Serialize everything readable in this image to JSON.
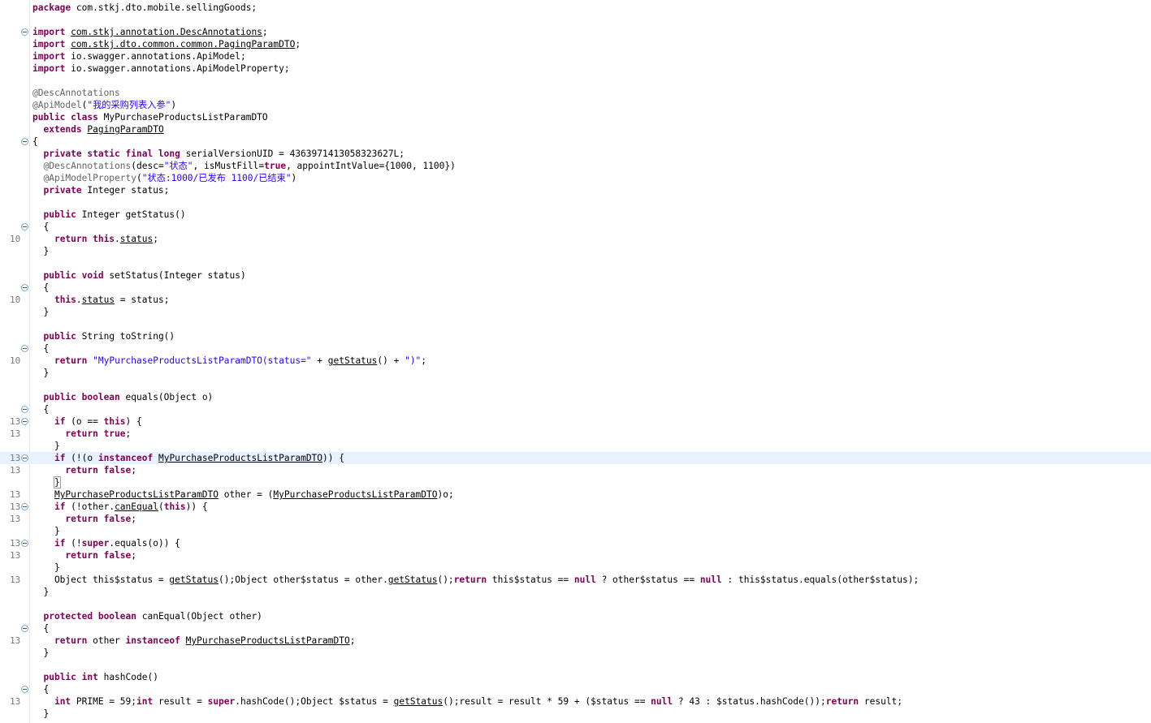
{
  "lines": [
    {
      "ln": "",
      "fold": false,
      "tokens": [
        {
          "t": "package",
          "c": "kw"
        },
        {
          "t": " com.stkj.dto.mobile.sellingGoods;"
        }
      ]
    },
    {
      "ln": "",
      "fold": false,
      "tokens": []
    },
    {
      "ln": "",
      "fold": true,
      "tokens": [
        {
          "t": "import",
          "c": "kw"
        },
        {
          "t": " "
        },
        {
          "t": "com.stkj.annotation.DescAnnotations",
          "c": "u"
        },
        {
          "t": ";"
        }
      ]
    },
    {
      "ln": "",
      "fold": false,
      "tokens": [
        {
          "t": "import",
          "c": "kw"
        },
        {
          "t": " "
        },
        {
          "t": "com.stkj.dto.common.common.PagingParamDTO",
          "c": "u"
        },
        {
          "t": ";"
        }
      ]
    },
    {
      "ln": "",
      "fold": false,
      "tokens": [
        {
          "t": "import",
          "c": "kw"
        },
        {
          "t": " io.swagger.annotations.ApiModel;"
        }
      ]
    },
    {
      "ln": "",
      "fold": false,
      "tokens": [
        {
          "t": "import",
          "c": "kw"
        },
        {
          "t": " io.swagger.annotations.ApiModelProperty;"
        }
      ]
    },
    {
      "ln": "",
      "fold": false,
      "tokens": []
    },
    {
      "ln": "",
      "fold": false,
      "tokens": [
        {
          "t": "@DescAnnotations",
          "c": "ann"
        }
      ]
    },
    {
      "ln": "",
      "fold": false,
      "tokens": [
        {
          "t": "@ApiModel",
          "c": "ann"
        },
        {
          "t": "("
        },
        {
          "t": "\"我的采购列表入参\"",
          "c": "str"
        },
        {
          "t": ")"
        }
      ]
    },
    {
      "ln": "",
      "fold": false,
      "tokens": [
        {
          "t": "public",
          "c": "kw"
        },
        {
          "t": " "
        },
        {
          "t": "class",
          "c": "kw"
        },
        {
          "t": " MyPurchaseProductsListParamDTO"
        }
      ]
    },
    {
      "ln": "",
      "fold": false,
      "tokens": [
        {
          "t": "  "
        },
        {
          "t": "extends",
          "c": "kw"
        },
        {
          "t": " "
        },
        {
          "t": "PagingParamDTO",
          "c": "u"
        }
      ]
    },
    {
      "ln": "",
      "fold": true,
      "tokens": [
        {
          "t": "{"
        }
      ]
    },
    {
      "ln": "",
      "fold": false,
      "tokens": [
        {
          "t": "  "
        },
        {
          "t": "private static final long",
          "c": "kw"
        },
        {
          "t": " serialVersionUID = 4363971413058323627L;"
        }
      ]
    },
    {
      "ln": "",
      "fold": false,
      "tokens": [
        {
          "t": "  "
        },
        {
          "t": "@DescAnnotations",
          "c": "ann"
        },
        {
          "t": "(desc="
        },
        {
          "t": "\"状态\"",
          "c": "str"
        },
        {
          "t": ", isMustFill="
        },
        {
          "t": "true",
          "c": "kw"
        },
        {
          "t": ", appointIntValue={1000, 1100})"
        }
      ]
    },
    {
      "ln": "",
      "fold": false,
      "tokens": [
        {
          "t": "  "
        },
        {
          "t": "@ApiModelProperty",
          "c": "ann"
        },
        {
          "t": "("
        },
        {
          "t": "\"状态:1000/已发布 1100/已结束\"",
          "c": "str"
        },
        {
          "t": ")"
        }
      ]
    },
    {
      "ln": "",
      "fold": false,
      "tokens": [
        {
          "t": "  "
        },
        {
          "t": "private",
          "c": "kw"
        },
        {
          "t": " Integer status;"
        }
      ]
    },
    {
      "ln": "",
      "fold": false,
      "tokens": []
    },
    {
      "ln": "",
      "fold": false,
      "tokens": [
        {
          "t": "  "
        },
        {
          "t": "public",
          "c": "kw"
        },
        {
          "t": " Integer getStatus()"
        }
      ]
    },
    {
      "ln": "",
      "fold": true,
      "tokens": [
        {
          "t": "  {"
        }
      ]
    },
    {
      "ln": "10",
      "fold": false,
      "tokens": [
        {
          "t": "    "
        },
        {
          "t": "return this",
          "c": "kw"
        },
        {
          "t": "."
        },
        {
          "t": "status",
          "c": "u"
        },
        {
          "t": ";"
        }
      ]
    },
    {
      "ln": "",
      "fold": false,
      "tokens": [
        {
          "t": "  }"
        }
      ]
    },
    {
      "ln": "",
      "fold": false,
      "tokens": []
    },
    {
      "ln": "",
      "fold": false,
      "tokens": [
        {
          "t": "  "
        },
        {
          "t": "public void",
          "c": "kw"
        },
        {
          "t": " setStatus(Integer status)"
        }
      ]
    },
    {
      "ln": "",
      "fold": true,
      "tokens": [
        {
          "t": "  {"
        }
      ]
    },
    {
      "ln": "10",
      "fold": false,
      "tokens": [
        {
          "t": "    "
        },
        {
          "t": "this",
          "c": "kw"
        },
        {
          "t": "."
        },
        {
          "t": "status",
          "c": "u"
        },
        {
          "t": " = status;"
        }
      ]
    },
    {
      "ln": "",
      "fold": false,
      "tokens": [
        {
          "t": "  }"
        }
      ]
    },
    {
      "ln": "",
      "fold": false,
      "tokens": []
    },
    {
      "ln": "",
      "fold": false,
      "tokens": [
        {
          "t": "  "
        },
        {
          "t": "public",
          "c": "kw"
        },
        {
          "t": " String toString()"
        }
      ]
    },
    {
      "ln": "",
      "fold": true,
      "tokens": [
        {
          "t": "  {"
        }
      ]
    },
    {
      "ln": "10",
      "fold": false,
      "tokens": [
        {
          "t": "    "
        },
        {
          "t": "return",
          "c": "kw"
        },
        {
          "t": " "
        },
        {
          "t": "\"MyPurchaseProductsListParamDTO(status=\"",
          "c": "str"
        },
        {
          "t": " + "
        },
        {
          "t": "getStatus",
          "c": "u"
        },
        {
          "t": "() + "
        },
        {
          "t": "\")\"",
          "c": "str"
        },
        {
          "t": ";"
        }
      ]
    },
    {
      "ln": "",
      "fold": false,
      "tokens": [
        {
          "t": "  }"
        }
      ]
    },
    {
      "ln": "",
      "fold": false,
      "tokens": []
    },
    {
      "ln": "",
      "fold": false,
      "tokens": [
        {
          "t": "  "
        },
        {
          "t": "public boolean",
          "c": "kw"
        },
        {
          "t": " equals(Object o)"
        }
      ]
    },
    {
      "ln": "",
      "fold": true,
      "tokens": [
        {
          "t": "  {"
        }
      ]
    },
    {
      "ln": "13",
      "fold": true,
      "tokens": [
        {
          "t": "    "
        },
        {
          "t": "if",
          "c": "kw"
        },
        {
          "t": " (o == "
        },
        {
          "t": "this",
          "c": "kw"
        },
        {
          "t": ") {"
        }
      ]
    },
    {
      "ln": "13",
      "fold": false,
      "tokens": [
        {
          "t": "      "
        },
        {
          "t": "return true",
          "c": "kw"
        },
        {
          "t": ";"
        }
      ]
    },
    {
      "ln": "",
      "fold": false,
      "tokens": [
        {
          "t": "    }"
        }
      ]
    },
    {
      "ln": "13",
      "fold": true,
      "hl": true,
      "tokens": [
        {
          "t": "    "
        },
        {
          "t": "if",
          "c": "kw"
        },
        {
          "t": " (!(o "
        },
        {
          "t": "instanceof",
          "c": "kw"
        },
        {
          "t": " "
        },
        {
          "t": "MyPurchaseProductsListParamDTO",
          "c": "u"
        },
        {
          "t": ")) {"
        }
      ]
    },
    {
      "ln": "13",
      "fold": false,
      "tokens": [
        {
          "t": "      "
        },
        {
          "t": "return false",
          "c": "kw"
        },
        {
          "t": ";"
        }
      ]
    },
    {
      "ln": "",
      "fold": false,
      "tokens": [
        {
          "t": "    "
        },
        {
          "t": "}",
          "c": "bracket"
        }
      ]
    },
    {
      "ln": "13",
      "fold": false,
      "tokens": [
        {
          "t": "    "
        },
        {
          "t": "MyPurchaseProductsListParamDTO",
          "c": "u"
        },
        {
          "t": " other = ("
        },
        {
          "t": "MyPurchaseProductsListParamDTO",
          "c": "u"
        },
        {
          "t": ")o;"
        }
      ]
    },
    {
      "ln": "13",
      "fold": true,
      "tokens": [
        {
          "t": "    "
        },
        {
          "t": "if",
          "c": "kw"
        },
        {
          "t": " (!other."
        },
        {
          "t": "canEqual",
          "c": "u"
        },
        {
          "t": "("
        },
        {
          "t": "this",
          "c": "kw"
        },
        {
          "t": ")) {"
        }
      ]
    },
    {
      "ln": "13",
      "fold": false,
      "tokens": [
        {
          "t": "      "
        },
        {
          "t": "return false",
          "c": "kw"
        },
        {
          "t": ";"
        }
      ]
    },
    {
      "ln": "",
      "fold": false,
      "tokens": [
        {
          "t": "    }"
        }
      ]
    },
    {
      "ln": "13",
      "fold": true,
      "tokens": [
        {
          "t": "    "
        },
        {
          "t": "if",
          "c": "kw"
        },
        {
          "t": " (!"
        },
        {
          "t": "super",
          "c": "kw"
        },
        {
          "t": ".equals(o)) {"
        }
      ]
    },
    {
      "ln": "13",
      "fold": false,
      "tokens": [
        {
          "t": "      "
        },
        {
          "t": "return false",
          "c": "kw"
        },
        {
          "t": ";"
        }
      ]
    },
    {
      "ln": "",
      "fold": false,
      "tokens": [
        {
          "t": "    }"
        }
      ]
    },
    {
      "ln": "13",
      "fold": false,
      "tokens": [
        {
          "t": "    Object this$status = "
        },
        {
          "t": "getStatus",
          "c": "u"
        },
        {
          "t": "();Object other$status = other."
        },
        {
          "t": "getStatus",
          "c": "u"
        },
        {
          "t": "();"
        },
        {
          "t": "return",
          "c": "kw"
        },
        {
          "t": " this$status == "
        },
        {
          "t": "null",
          "c": "kw"
        },
        {
          "t": " ? other$status == "
        },
        {
          "t": "null",
          "c": "kw"
        },
        {
          "t": " : this$status.equals(other$status);"
        }
      ]
    },
    {
      "ln": "",
      "fold": false,
      "tokens": [
        {
          "t": "  }"
        }
      ]
    },
    {
      "ln": "",
      "fold": false,
      "tokens": []
    },
    {
      "ln": "",
      "fold": false,
      "tokens": [
        {
          "t": "  "
        },
        {
          "t": "protected boolean",
          "c": "kw"
        },
        {
          "t": " canEqual(Object other)"
        }
      ]
    },
    {
      "ln": "",
      "fold": true,
      "tokens": [
        {
          "t": "  {"
        }
      ]
    },
    {
      "ln": "13",
      "fold": false,
      "tokens": [
        {
          "t": "    "
        },
        {
          "t": "return",
          "c": "kw"
        },
        {
          "t": " other "
        },
        {
          "t": "instanceof",
          "c": "kw"
        },
        {
          "t": " "
        },
        {
          "t": "MyPurchaseProductsListParamDTO",
          "c": "u"
        },
        {
          "t": ";"
        }
      ]
    },
    {
      "ln": "",
      "fold": false,
      "tokens": [
        {
          "t": "  }"
        }
      ]
    },
    {
      "ln": "",
      "fold": false,
      "tokens": []
    },
    {
      "ln": "",
      "fold": false,
      "tokens": [
        {
          "t": "  "
        },
        {
          "t": "public int",
          "c": "kw"
        },
        {
          "t": " hashCode()"
        }
      ]
    },
    {
      "ln": "",
      "fold": true,
      "tokens": [
        {
          "t": "  {"
        }
      ]
    },
    {
      "ln": "13",
      "fold": false,
      "tokens": [
        {
          "t": "    "
        },
        {
          "t": "int",
          "c": "kw"
        },
        {
          "t": " PRIME = 59;"
        },
        {
          "t": "int",
          "c": "kw"
        },
        {
          "t": " result = "
        },
        {
          "t": "super",
          "c": "kw"
        },
        {
          "t": ".hashCode();Object $status = "
        },
        {
          "t": "getStatus",
          "c": "u"
        },
        {
          "t": "();result = result * 59 + ($status == "
        },
        {
          "t": "null",
          "c": "kw"
        },
        {
          "t": " ? 43 : $status.hashCode());"
        },
        {
          "t": "return",
          "c": "kw"
        },
        {
          "t": " result;"
        }
      ]
    },
    {
      "ln": "",
      "fold": false,
      "tokens": [
        {
          "t": "  }"
        }
      ]
    }
  ]
}
